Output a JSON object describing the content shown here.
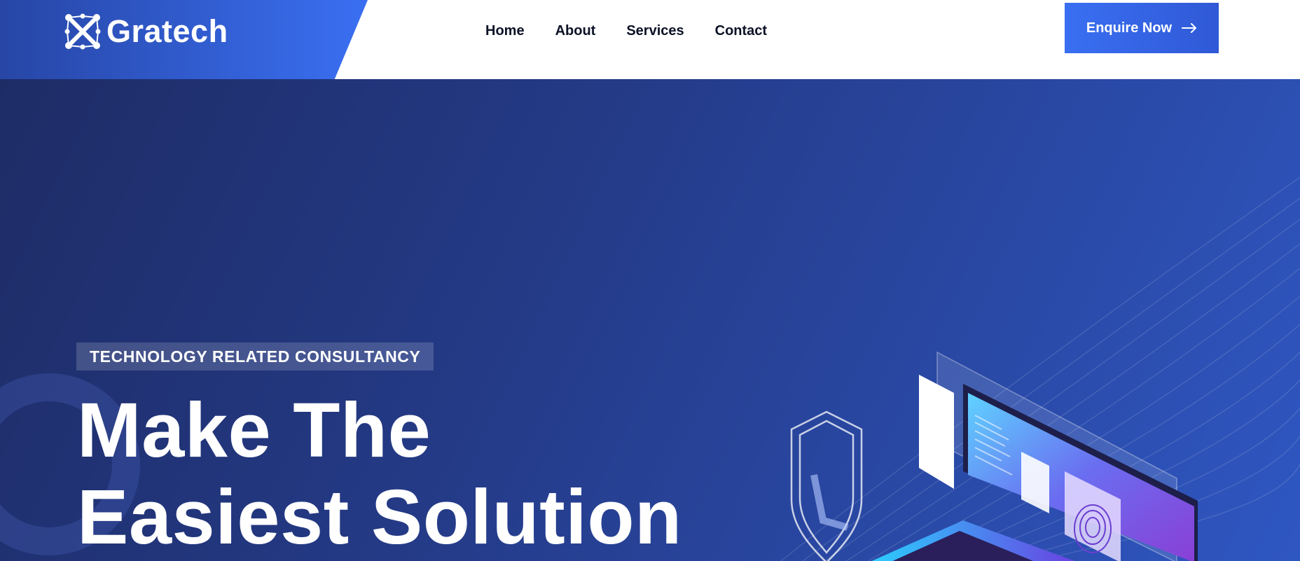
{
  "brand": {
    "name": "Gratech",
    "logo_icon": "x-network-logo-icon"
  },
  "nav": {
    "items": [
      {
        "label": "Home"
      },
      {
        "label": "About"
      },
      {
        "label": "Services"
      },
      {
        "label": "Contact"
      }
    ]
  },
  "cta": {
    "label": "Enquire Now",
    "icon": "arrow-right-icon"
  },
  "hero": {
    "badge": "TECHNOLOGY RELATED CONSULTANCY",
    "title_line1": "Make The",
    "title_line2": "Easiest Solution"
  },
  "colors": {
    "accent": "#3a6ff2",
    "hero_dark": "#1e2c66",
    "hero_light": "#2f57c2",
    "nav_text": "#0c1226"
  }
}
